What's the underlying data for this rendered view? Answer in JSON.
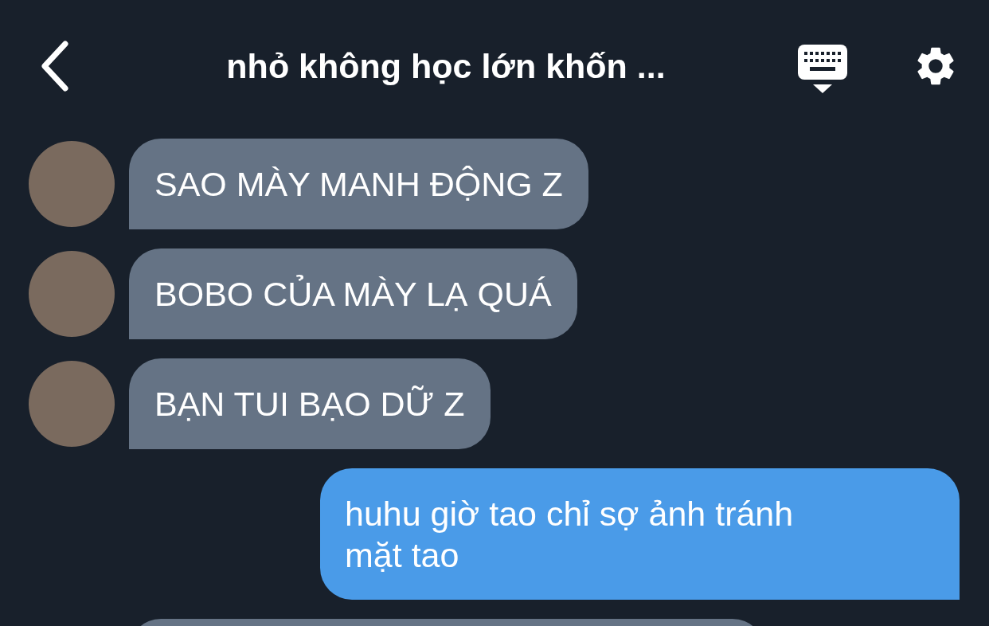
{
  "header": {
    "title": "nhỏ không học lớn khốn ..."
  },
  "messages": [
    {
      "kind": "incoming",
      "avatar": true,
      "text": "SAO MÀY MANH ĐỘNG Z"
    },
    {
      "kind": "incoming",
      "avatar": true,
      "text": "BOBO CỦA MÀY LẠ QUÁ"
    },
    {
      "kind": "incoming",
      "avatar": true,
      "text": "BẠN TUI BẠO DỮ Z"
    },
    {
      "kind": "outgoing",
      "text": "huhu giờ tao chỉ sợ ảnh tránh mặt tao"
    },
    {
      "kind": "incoming",
      "avatar": false
    }
  ]
}
